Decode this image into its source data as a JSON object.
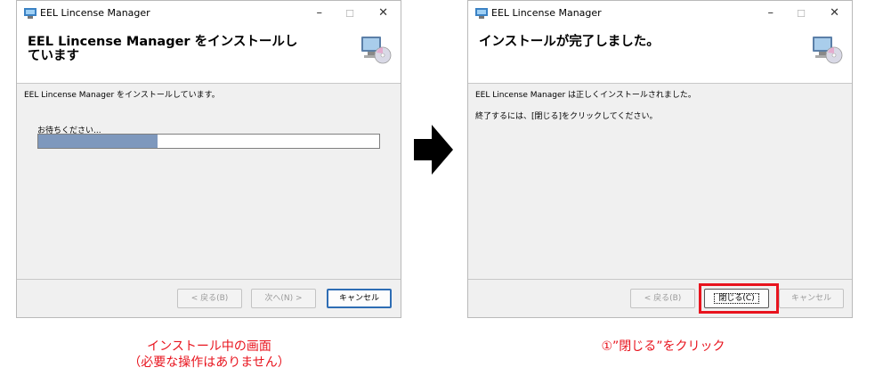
{
  "left_window": {
    "title": "EEL Lincense Manager",
    "controls": {
      "minimize": "–",
      "maximize": "☐",
      "close": "✕"
    },
    "header_title": "EEL Lincense Manager をインストールしています",
    "body_text": "EEL Lincense Manager をインストールしています。",
    "wait_label": "お待ちください...",
    "progress_fraction": 0.35,
    "buttons": {
      "back": "< 戻る(B)",
      "next": "次へ(N) >",
      "cancel": "キャンセル"
    }
  },
  "right_window": {
    "title": "EEL Lincense Manager",
    "controls": {
      "minimize": "–",
      "maximize": "☐",
      "close": "✕"
    },
    "header_title": "インストールが完了しました。",
    "body_line1": "EEL Lincense Manager は正しくインストールされました。",
    "body_line2": "終了するには、[閉じる]をクリックしてください。",
    "buttons": {
      "back": "< 戻る(B)",
      "close": "閉じる(C)",
      "cancel": "キャンセル"
    }
  },
  "captions": {
    "left_line1": "インストール中の画面",
    "left_line2": "（必要な操作はありません）",
    "right": "①”閉じる”をクリック"
  },
  "colors": {
    "accent_red": "#e8141e",
    "progress_fill": "#7e98bd"
  },
  "icons": [
    "installer-app-icon",
    "computer-disc-icon",
    "right-arrow-icon"
  ]
}
